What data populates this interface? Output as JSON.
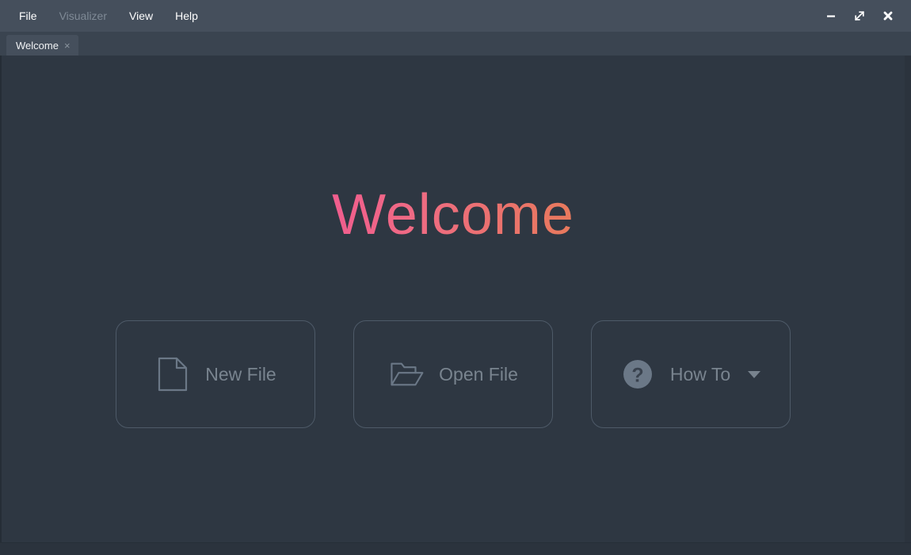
{
  "window": {
    "background_color": "#2e3742",
    "titlebar_color": "#454f5c",
    "tabbar_color": "#3a4450"
  },
  "menu": {
    "items": [
      {
        "label": "File",
        "disabled": false
      },
      {
        "label": "Visualizer",
        "disabled": true
      },
      {
        "label": "View",
        "disabled": false
      },
      {
        "label": "Help",
        "disabled": false
      }
    ]
  },
  "window_controls": [
    {
      "name": "minimize-button",
      "icon": "minimize-icon"
    },
    {
      "name": "maximize-button",
      "icon": "maximize-icon"
    },
    {
      "name": "close-button",
      "icon": "close-icon"
    }
  ],
  "tabs": [
    {
      "label": "Welcome",
      "close": "×",
      "active": true
    }
  ],
  "main": {
    "title": "Welcome",
    "title_gradient_start": "#f05d8e",
    "title_gradient_end": "#e87a5c",
    "cards": [
      {
        "label": "New File",
        "icon": "document-icon",
        "has_chevron": false
      },
      {
        "label": "Open File",
        "icon": "open-folder-icon",
        "has_chevron": false
      },
      {
        "label": "How To",
        "icon": "question-circle-icon",
        "has_chevron": true
      }
    ],
    "card_border_color": "#4e5a68",
    "card_text_color": "#79848f"
  }
}
